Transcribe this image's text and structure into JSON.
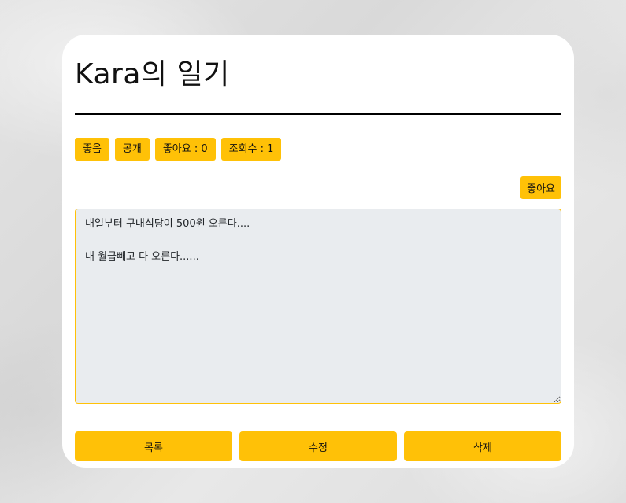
{
  "page": {
    "title": "Kara의 일기"
  },
  "badges": {
    "mood": "좋음",
    "visibility": "공개",
    "likes": "좋아요 : 0",
    "views": "조회수 : 1"
  },
  "like_button": {
    "label": "좋아요"
  },
  "content": {
    "text": "내일부터 구내식당이 500원 오른다....\n\n내 월급빼고 다 오른다......"
  },
  "actions": {
    "list_label": "목록",
    "edit_label": "수정",
    "delete_label": "삭제"
  },
  "colors": {
    "accent": "#ffc107",
    "card": "#ffffff",
    "textarea_bg": "#e9ecef"
  }
}
